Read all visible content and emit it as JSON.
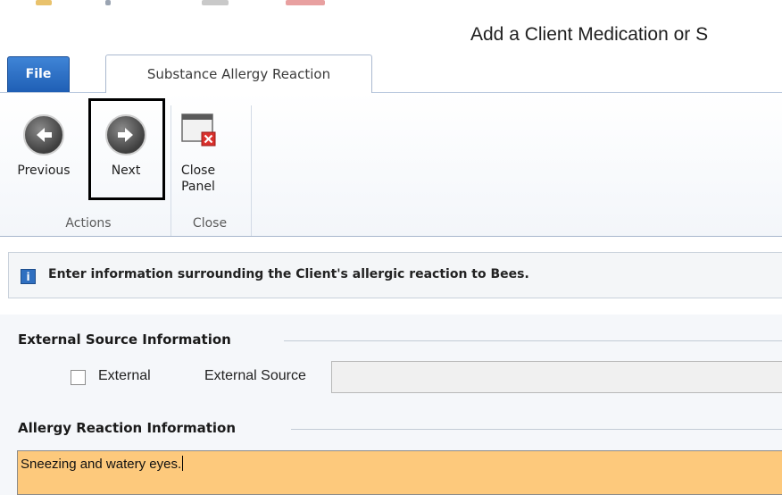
{
  "window": {
    "title": "Add a Client Medication or S"
  },
  "tabs": {
    "file_label": "File",
    "active_label": "Substance Allergy Reaction"
  },
  "ribbon": {
    "previous_label": "Previous",
    "next_label": "Next",
    "close_panel_label_line1": "Close",
    "close_panel_label_line2": "Panel",
    "group_actions_label": "Actions",
    "group_close_label": "Close"
  },
  "info": {
    "message": "Enter information surrounding the Client's allergic reaction to Bees."
  },
  "external_section": {
    "heading": "External Source Information",
    "external_checkbox_label": "External",
    "external_checked": false,
    "external_source_label": "External Source",
    "external_source_value": ""
  },
  "reaction_section": {
    "heading": "Allergy Reaction Information",
    "reaction_text": "Sneezing and watery eyes."
  },
  "colors": {
    "file_tab": "#2a6fc8",
    "reaction_field_bg": "#fdc97c",
    "info_icon": "#2f6fc0"
  },
  "icons": {
    "previous": "arrow-left-circle-icon",
    "next": "arrow-right-circle-icon",
    "close_panel": "close-panel-window-icon",
    "info": "info-icon"
  }
}
